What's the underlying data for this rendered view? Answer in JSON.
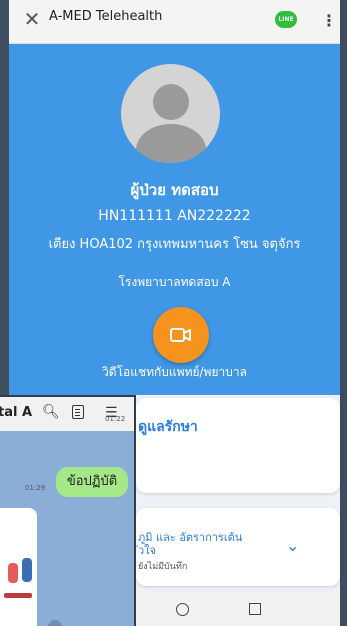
{
  "app": {
    "title": "A-MED Telehealth",
    "line_badge": "LINE"
  },
  "patient": {
    "name": "ผู้ป่วย ทดสอบ",
    "ids": "HN111111 AN222222",
    "bed": "เตียง HOA102 กรุงเทพมหานคร โซน จตุจักร",
    "hospital": "โรงพยาบาลทดสอบ A"
  },
  "video": {
    "label": "วิดีโอแชทกับแพทย์/พยาบาล"
  },
  "cards": {
    "care_title": "ดูแลรักษา",
    "vitals_line1": "ภูมิ และ อัตราการเต้น",
    "vitals_line2": "ัวใจ",
    "vitals_sub": "ยังไม่มีบันทึก"
  },
  "chat": {
    "room_name": "tal A",
    "time_prev": "01:22",
    "message": "ข้อปฏิบัติ",
    "time_msg": "01:29"
  },
  "colors": {
    "main_blue": "#3f97e6",
    "video_orange": "#f5931e",
    "bubble_green": "#a5e887",
    "accent_blue": "#2a7de1"
  }
}
